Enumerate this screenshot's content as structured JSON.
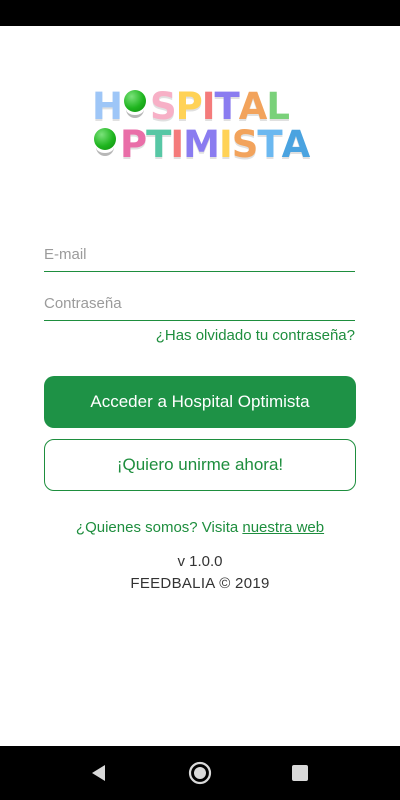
{
  "app": {
    "logo_line1": "HOSPITAL",
    "logo_line2": "OPTIMISTA",
    "logo_colors": [
      "#9ec6f7",
      "#f7b0c6",
      "#ffd256",
      "#7ad17a",
      "#f47b7b",
      "#8a7cf0",
      "#57c7a5",
      "#f2a35c",
      "#6bb8f0",
      "#e96ea8"
    ]
  },
  "login": {
    "email_placeholder": "E-mail",
    "password_placeholder": "Contraseña",
    "forgot_link": "¿Has olvidado tu contraseña?",
    "submit_label": "Acceder a Hospital Optimista",
    "join_label": "¡Quiero unirme ahora!"
  },
  "footer": {
    "about_text": "¿Quienes somos? Visita ",
    "about_link": "nuestra web",
    "version": "v 1.0.0",
    "copyright": "FEEDBALIA © 2019"
  },
  "colors": {
    "accent": "#1e9246",
    "accent_text": "#1e8e3e"
  },
  "system": {
    "nav_icons": [
      "back-icon",
      "home-icon",
      "recents-icon"
    ]
  }
}
